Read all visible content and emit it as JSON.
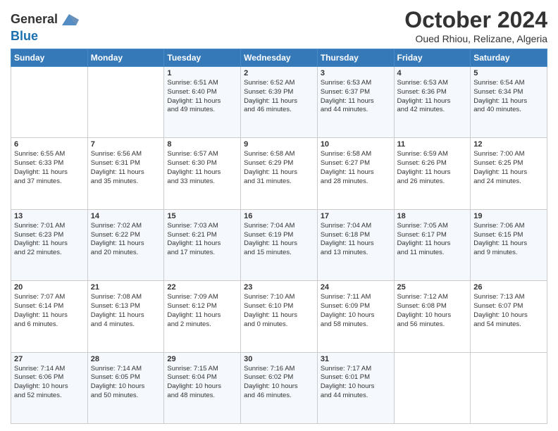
{
  "header": {
    "logo_line1": "General",
    "logo_line2": "Blue",
    "title": "October 2024",
    "subtitle": "Oued Rhiou, Relizane, Algeria"
  },
  "weekdays": [
    "Sunday",
    "Monday",
    "Tuesday",
    "Wednesday",
    "Thursday",
    "Friday",
    "Saturday"
  ],
  "weeks": [
    [
      {
        "day": "",
        "info": ""
      },
      {
        "day": "",
        "info": ""
      },
      {
        "day": "1",
        "info": "Sunrise: 6:51 AM\nSunset: 6:40 PM\nDaylight: 11 hours\nand 49 minutes."
      },
      {
        "day": "2",
        "info": "Sunrise: 6:52 AM\nSunset: 6:39 PM\nDaylight: 11 hours\nand 46 minutes."
      },
      {
        "day": "3",
        "info": "Sunrise: 6:53 AM\nSunset: 6:37 PM\nDaylight: 11 hours\nand 44 minutes."
      },
      {
        "day": "4",
        "info": "Sunrise: 6:53 AM\nSunset: 6:36 PM\nDaylight: 11 hours\nand 42 minutes."
      },
      {
        "day": "5",
        "info": "Sunrise: 6:54 AM\nSunset: 6:34 PM\nDaylight: 11 hours\nand 40 minutes."
      }
    ],
    [
      {
        "day": "6",
        "info": "Sunrise: 6:55 AM\nSunset: 6:33 PM\nDaylight: 11 hours\nand 37 minutes."
      },
      {
        "day": "7",
        "info": "Sunrise: 6:56 AM\nSunset: 6:31 PM\nDaylight: 11 hours\nand 35 minutes."
      },
      {
        "day": "8",
        "info": "Sunrise: 6:57 AM\nSunset: 6:30 PM\nDaylight: 11 hours\nand 33 minutes."
      },
      {
        "day": "9",
        "info": "Sunrise: 6:58 AM\nSunset: 6:29 PM\nDaylight: 11 hours\nand 31 minutes."
      },
      {
        "day": "10",
        "info": "Sunrise: 6:58 AM\nSunset: 6:27 PM\nDaylight: 11 hours\nand 28 minutes."
      },
      {
        "day": "11",
        "info": "Sunrise: 6:59 AM\nSunset: 6:26 PM\nDaylight: 11 hours\nand 26 minutes."
      },
      {
        "day": "12",
        "info": "Sunrise: 7:00 AM\nSunset: 6:25 PM\nDaylight: 11 hours\nand 24 minutes."
      }
    ],
    [
      {
        "day": "13",
        "info": "Sunrise: 7:01 AM\nSunset: 6:23 PM\nDaylight: 11 hours\nand 22 minutes."
      },
      {
        "day": "14",
        "info": "Sunrise: 7:02 AM\nSunset: 6:22 PM\nDaylight: 11 hours\nand 20 minutes."
      },
      {
        "day": "15",
        "info": "Sunrise: 7:03 AM\nSunset: 6:21 PM\nDaylight: 11 hours\nand 17 minutes."
      },
      {
        "day": "16",
        "info": "Sunrise: 7:04 AM\nSunset: 6:19 PM\nDaylight: 11 hours\nand 15 minutes."
      },
      {
        "day": "17",
        "info": "Sunrise: 7:04 AM\nSunset: 6:18 PM\nDaylight: 11 hours\nand 13 minutes."
      },
      {
        "day": "18",
        "info": "Sunrise: 7:05 AM\nSunset: 6:17 PM\nDaylight: 11 hours\nand 11 minutes."
      },
      {
        "day": "19",
        "info": "Sunrise: 7:06 AM\nSunset: 6:15 PM\nDaylight: 11 hours\nand 9 minutes."
      }
    ],
    [
      {
        "day": "20",
        "info": "Sunrise: 7:07 AM\nSunset: 6:14 PM\nDaylight: 11 hours\nand 6 minutes."
      },
      {
        "day": "21",
        "info": "Sunrise: 7:08 AM\nSunset: 6:13 PM\nDaylight: 11 hours\nand 4 minutes."
      },
      {
        "day": "22",
        "info": "Sunrise: 7:09 AM\nSunset: 6:12 PM\nDaylight: 11 hours\nand 2 minutes."
      },
      {
        "day": "23",
        "info": "Sunrise: 7:10 AM\nSunset: 6:10 PM\nDaylight: 11 hours\nand 0 minutes."
      },
      {
        "day": "24",
        "info": "Sunrise: 7:11 AM\nSunset: 6:09 PM\nDaylight: 10 hours\nand 58 minutes."
      },
      {
        "day": "25",
        "info": "Sunrise: 7:12 AM\nSunset: 6:08 PM\nDaylight: 10 hours\nand 56 minutes."
      },
      {
        "day": "26",
        "info": "Sunrise: 7:13 AM\nSunset: 6:07 PM\nDaylight: 10 hours\nand 54 minutes."
      }
    ],
    [
      {
        "day": "27",
        "info": "Sunrise: 7:14 AM\nSunset: 6:06 PM\nDaylight: 10 hours\nand 52 minutes."
      },
      {
        "day": "28",
        "info": "Sunrise: 7:14 AM\nSunset: 6:05 PM\nDaylight: 10 hours\nand 50 minutes."
      },
      {
        "day": "29",
        "info": "Sunrise: 7:15 AM\nSunset: 6:04 PM\nDaylight: 10 hours\nand 48 minutes."
      },
      {
        "day": "30",
        "info": "Sunrise: 7:16 AM\nSunset: 6:02 PM\nDaylight: 10 hours\nand 46 minutes."
      },
      {
        "day": "31",
        "info": "Sunrise: 7:17 AM\nSunset: 6:01 PM\nDaylight: 10 hours\nand 44 minutes."
      },
      {
        "day": "",
        "info": ""
      },
      {
        "day": "",
        "info": ""
      }
    ]
  ]
}
